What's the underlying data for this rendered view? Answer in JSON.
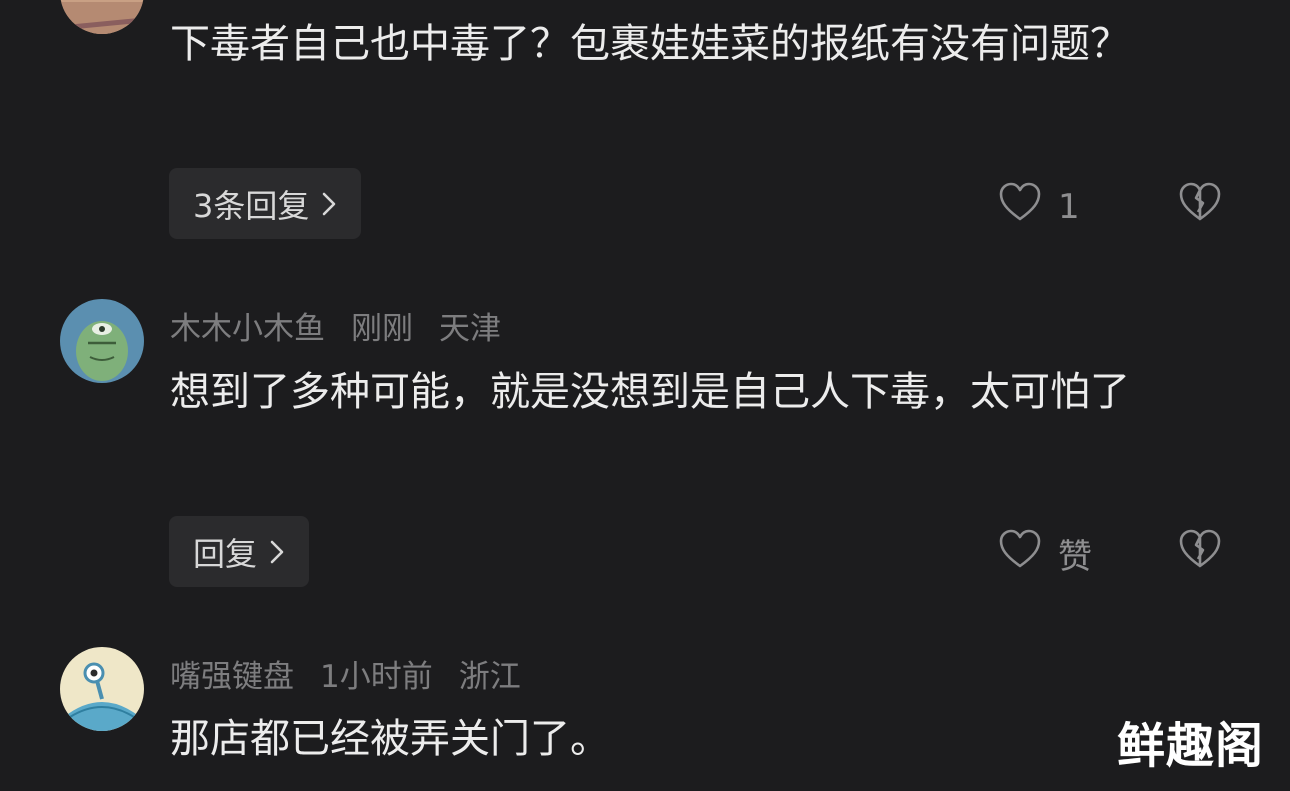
{
  "comments": [
    {
      "text": "下毒者自己也中毒了？包裹娃娃菜的报纸有没有问题？",
      "reply_label": "3条回复",
      "like_count": "1"
    },
    {
      "author": "木木小木鱼",
      "time": "刚刚",
      "location": "天津",
      "text": "想到了多种可能，就是没想到是自己人下毒，太可怕了",
      "reply_label": "回复",
      "like_count": "赞"
    },
    {
      "author": "嘴强键盘",
      "time": "1小时前",
      "location": "浙江",
      "text": "那店都已经被弄关门了。"
    }
  ],
  "icons": {
    "like": "heart-outline-icon",
    "dislike": "broken-heart-icon",
    "chevron": "chevron-right-icon"
  },
  "watermark": "鲜趣阁"
}
